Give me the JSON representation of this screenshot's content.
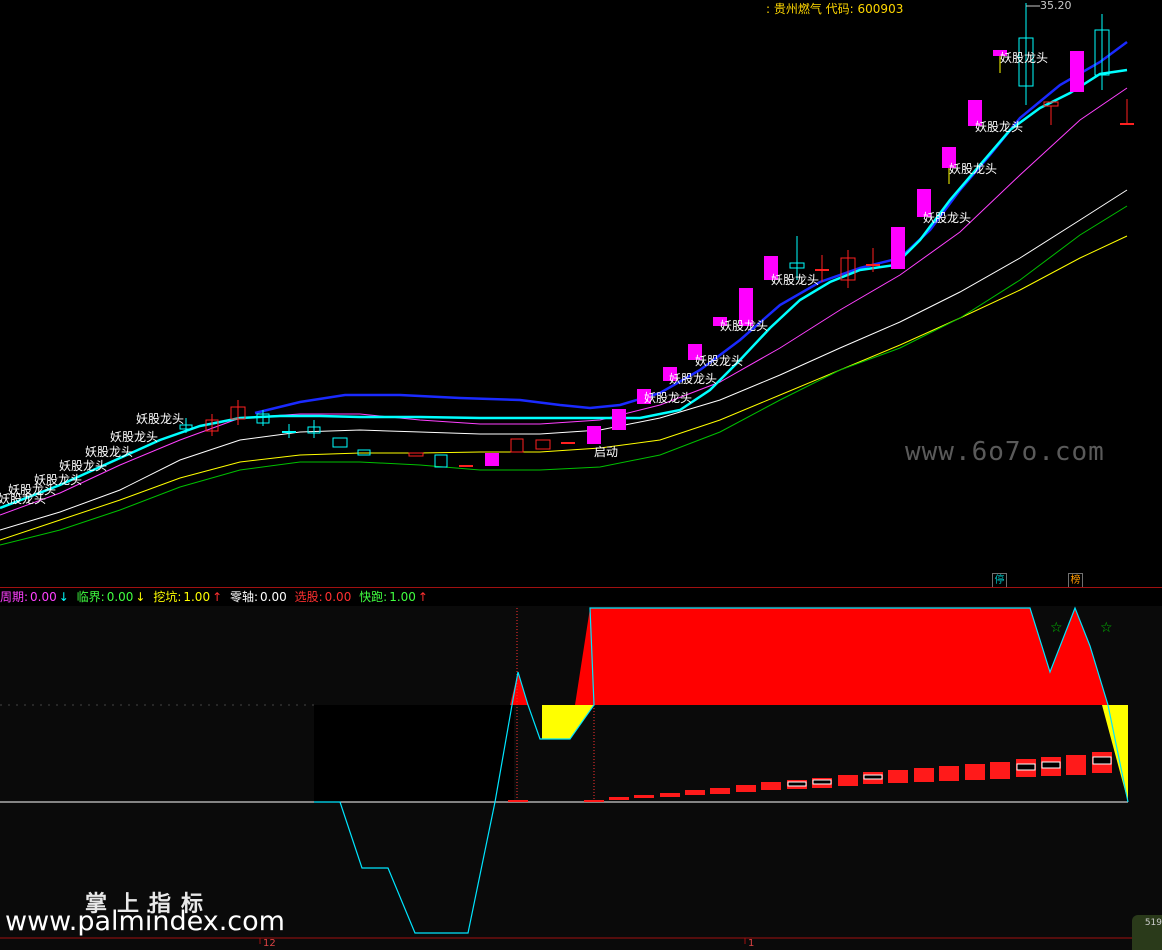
{
  "header": {
    "stock_title": ": 贵州燃气 代码: 600903",
    "max_price": "35.20"
  },
  "main_chart": {
    "labels": {
      "dragon_head": "妖股龙头",
      "start": "启动"
    },
    "badges": [
      {
        "text": "停",
        "color": "#00c8c8"
      },
      {
        "text": "榜",
        "color": "#ff9900"
      }
    ],
    "watermark": "www.6o7o.com"
  },
  "indicator_bar": {
    "items": [
      {
        "name": "周期:",
        "value": "0.00",
        "arrow": "↓",
        "color": "#ff40ff",
        "arrow_color": "#00ffff"
      },
      {
        "name": "临界:",
        "value": "0.00",
        "arrow": "↓",
        "color": "#40ff40",
        "arrow_color": "#ffff00"
      },
      {
        "name": "挖坑:",
        "value": "1.00",
        "arrow": "↑",
        "color": "#ffff00",
        "arrow_color": "#ff3030"
      },
      {
        "name": "零轴:",
        "value": "0.00",
        "arrow": "",
        "color": "#ffffff",
        "arrow_color": "#ffffff"
      },
      {
        "name": "选股:",
        "value": "0.00",
        "arrow": "",
        "color": "#ff3030",
        "arrow_color": "#ffffff"
      },
      {
        "name": "快跑:",
        "value": "1.00",
        "arrow": "↑",
        "color": "#40ff40",
        "arrow_color": "#ff3030"
      }
    ]
  },
  "footer": {
    "brand_cn": "掌上指标",
    "brand_url": "www.palmindex.com",
    "date_ticks": [
      "12",
      "1"
    ],
    "corner_value": "519"
  },
  "colors": {
    "up": "#ff2020",
    "down": "#00ffff",
    "magenta": "#ff00ff",
    "ma_white": "#ffffff",
    "ma_yellow": "#ffff00",
    "ma_green": "#00c000",
    "blue_line": "#1a2aff"
  }
}
